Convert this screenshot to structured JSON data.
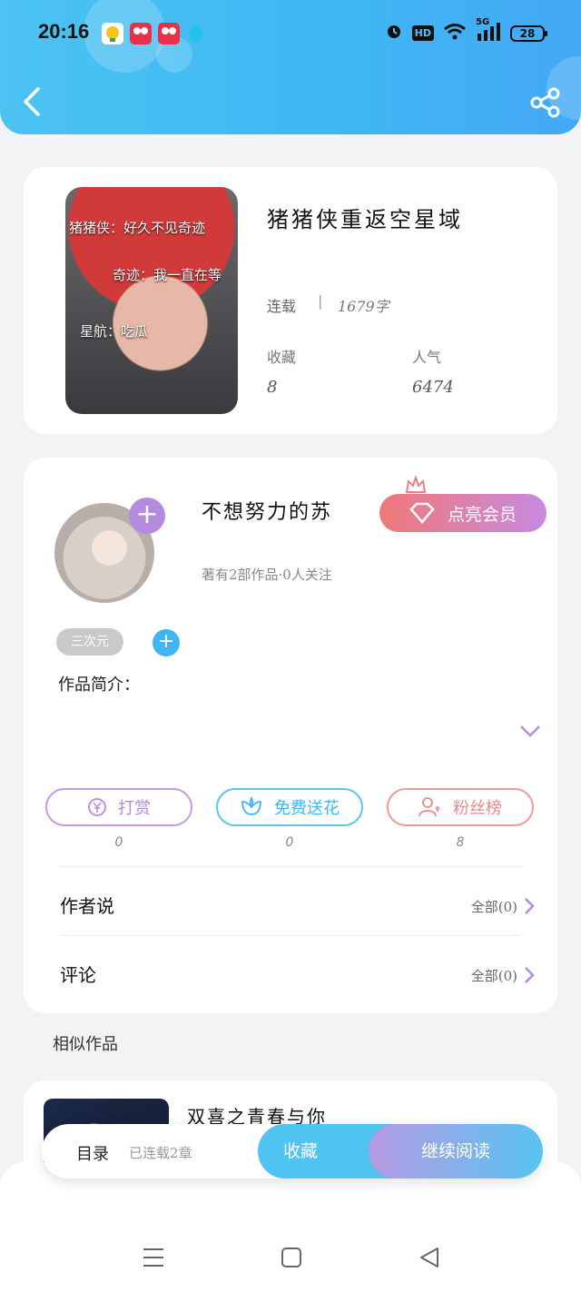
{
  "status_bar": {
    "time": "20:16",
    "hd": "HD",
    "network": "5G",
    "battery": "28",
    "icons": [
      "alarm-icon",
      "wifi-icon",
      "signal-icon",
      "battery-icon"
    ]
  },
  "header": {
    "back_icon": "back-chevron-icon",
    "share_icon": "share-icon",
    "gradient": [
      "#4cc3f2",
      "#44a9f5"
    ]
  },
  "book": {
    "title": "猪猪侠重返空星域",
    "cover_lines": [
      "猪猪侠：好久不见奇迹",
      "奇迹：我一直在等",
      "星航：吃瓜"
    ],
    "status": "连载",
    "word_count": "1679字",
    "favorites_label": "收藏",
    "favorites_value": "8",
    "popularity_label": "人气",
    "popularity_value": "6474"
  },
  "author": {
    "name": "不想努力的苏",
    "meta": "著有2部作品·0人关注",
    "vip_button": "点亮会员",
    "tag": "三次元",
    "intro_label": "作品简介："
  },
  "actions": [
    {
      "label": "打赏",
      "count": "0",
      "color": "#c39be8",
      "text_color": "#b48be0"
    },
    {
      "label": "免费送花",
      "count": "0",
      "color": "#58c6ef",
      "text_color": "#3fb6f3"
    },
    {
      "label": "粉丝榜",
      "count": "8",
      "color": "#ee9b9b",
      "text_color": "#e98a8a"
    }
  ],
  "rows": [
    {
      "label": "作者说",
      "value": "全部(0)"
    },
    {
      "label": "评论",
      "value": "全部(0)"
    }
  ],
  "similar": {
    "section_label": "相似作品",
    "title": "双喜之青春与你"
  },
  "bottom_bar": {
    "catalog": "目录",
    "status": "已连载2章",
    "collect": "收藏",
    "read": "继续阅读"
  }
}
